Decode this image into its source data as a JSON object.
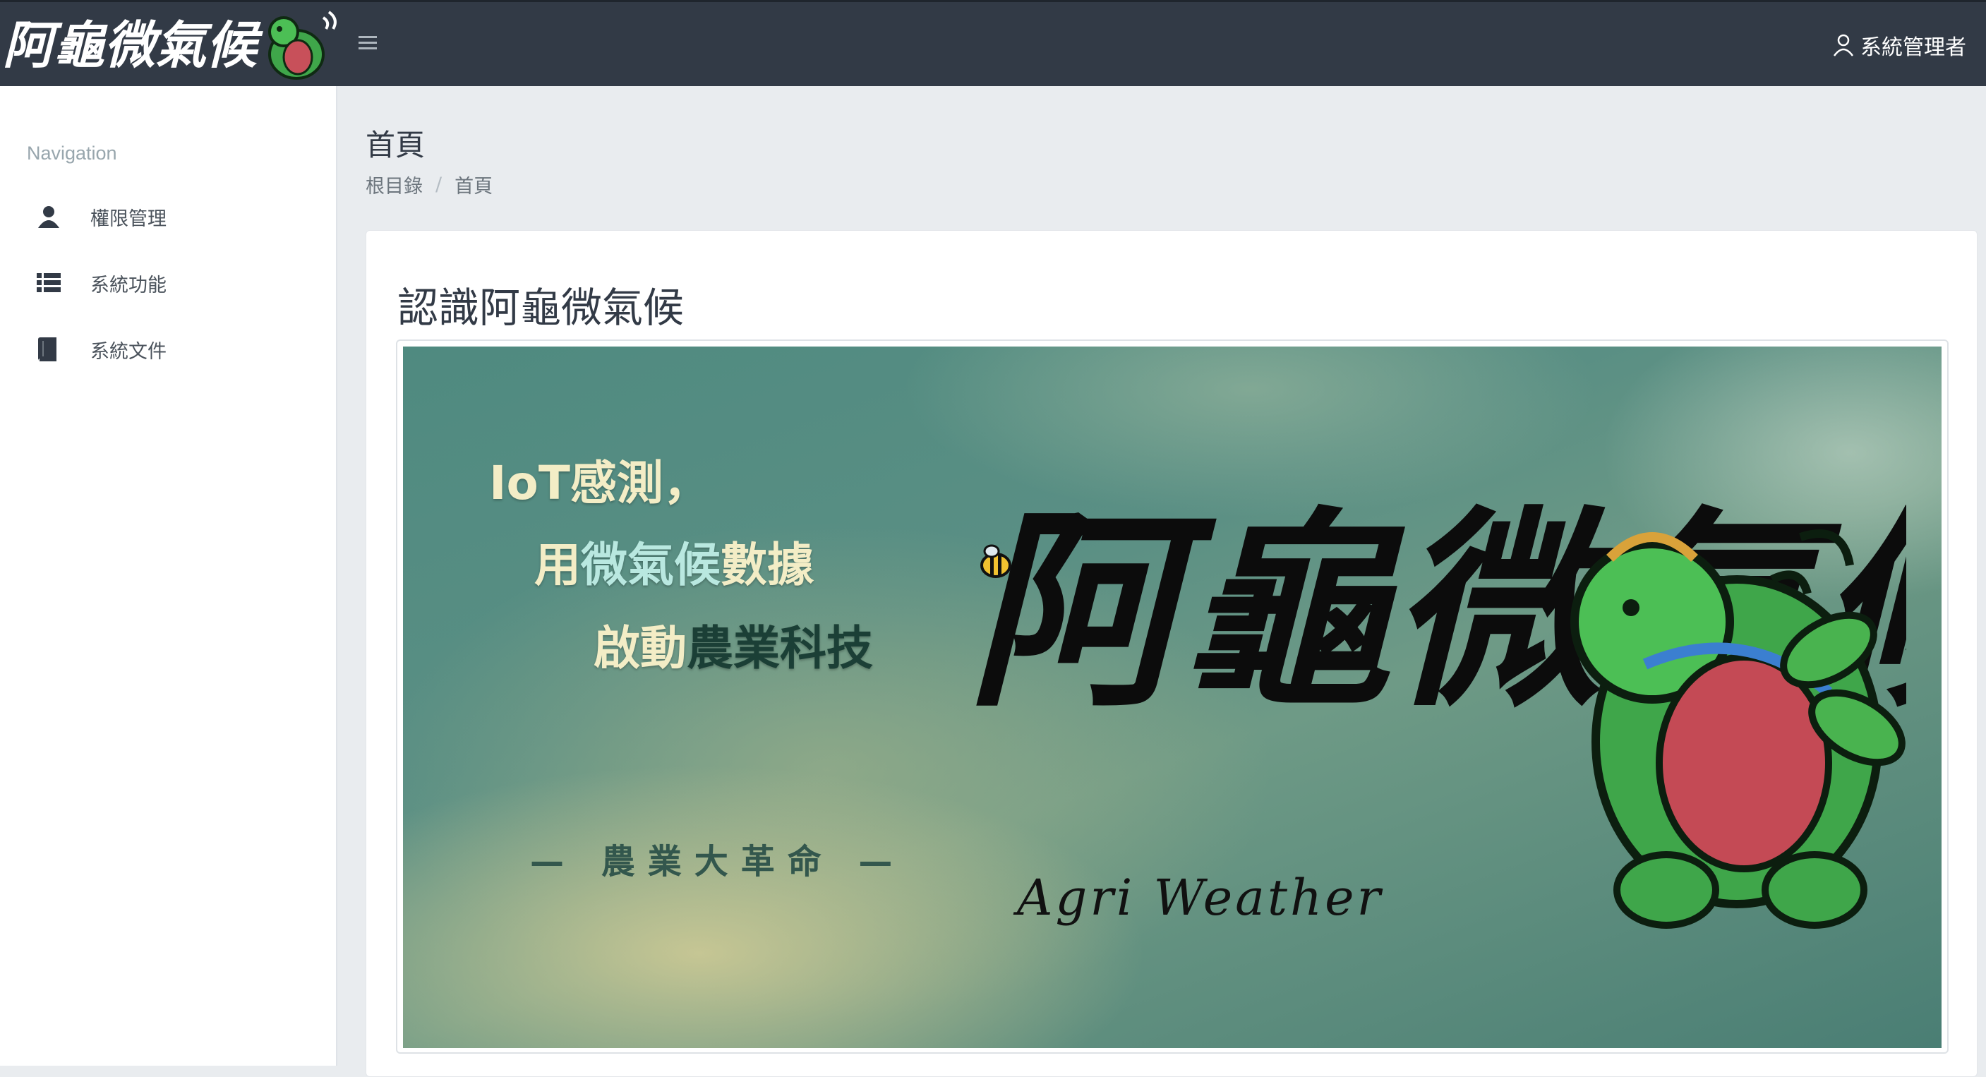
{
  "header": {
    "brand_name": "阿龜微氣候",
    "menu_icon": "hamburger-icon",
    "user_icon": "user-icon",
    "user_label": "系統管理者"
  },
  "sidebar": {
    "title": "Navigation",
    "items": [
      {
        "label": "權限管理",
        "icon": "user-icon"
      },
      {
        "label": "系統功能",
        "icon": "list-icon"
      },
      {
        "label": "系統文件",
        "icon": "book-icon"
      }
    ]
  },
  "page": {
    "title": "首頁",
    "breadcrumb": [
      "根目錄",
      "首頁"
    ],
    "breadcrumb_separator": "/"
  },
  "card": {
    "title": "認識阿龜微氣候"
  },
  "banner": {
    "line1": "IoT感測，",
    "line2_prefix": "用",
    "line2_highlight": "微氣候",
    "line2_suffix": "數據",
    "line3_prefix": "啟動",
    "line3_highlight": "農業科技",
    "sub_slogan": "— 農業大革命 —",
    "logo_text": "阿龜微氣候",
    "logo_subtitle": "Agri Weather"
  },
  "colors": {
    "topbar": "#323a46",
    "sidebar": "#ffffff",
    "content_bg": "#e9ecef",
    "banner_base": "#5a8f84"
  }
}
